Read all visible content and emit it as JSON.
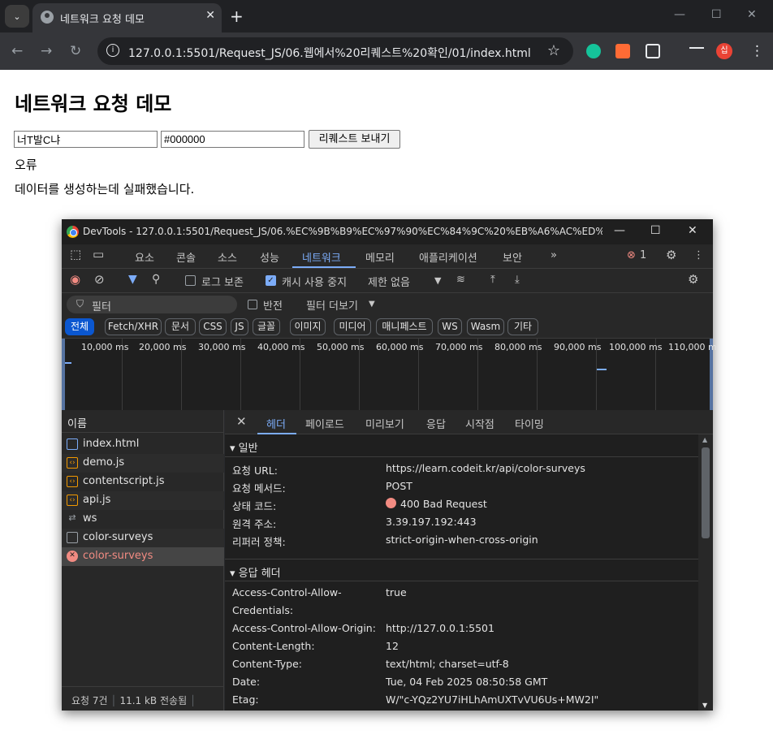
{
  "browser": {
    "tab_title": "네트워크 요청 데모",
    "tab_close": "✕",
    "new_tab": "+",
    "url": "127.0.0.1:5501/Request_JS/06.웹에서%20리퀘스트%20확인/01/index.html",
    "profile_initial": "십"
  },
  "page": {
    "heading": "네트워크 요청 데모",
    "name_value": "너T발C냐",
    "color_value": "#000000",
    "send_button": "리퀘스트 보내기",
    "error_title": "오류",
    "error_message": "데이터를 생성하는데 실패했습니다."
  },
  "devtools": {
    "window_title": "DevTools - 127.0.0.1:5501/Request_JS/06.%EC%9B%B9%EC%97%90%EC%84%9C%20%EB%A6%AC%ED%80%98%EC...",
    "panel_tabs": [
      "요소",
      "콘솔",
      "소스",
      "성능",
      "네트워크",
      "메모리",
      "애플리케이션",
      "보안"
    ],
    "more_tabs": "»",
    "error_count": "1",
    "toolbar": {
      "preserve_log": "로그 보존",
      "disable_cache": "캐시 사용 중지",
      "throttle": "제한 없음"
    },
    "filter": {
      "placeholder": "필터",
      "invert": "반전",
      "more_filters": "필터 더보기"
    },
    "type_filters": [
      "전체",
      "Fetch/XHR",
      "문서",
      "CSS",
      "JS",
      "글꼴",
      "이미지",
      "미디어",
      "매니페스트",
      "WS",
      "Wasm",
      "기타"
    ],
    "timeline_ticks": [
      "10,000 ms",
      "20,000 ms",
      "30,000 ms",
      "40,000 ms",
      "50,000 ms",
      "60,000 ms",
      "70,000 ms",
      "80,000 ms",
      "90,000 ms",
      "100,000 ms",
      "110,000 m"
    ],
    "name_header": "이름",
    "requests": [
      {
        "name": "index.html",
        "icon": "document-icon",
        "color": "#7cacf8"
      },
      {
        "name": "demo.js",
        "icon": "script-icon",
        "color": "#f29900"
      },
      {
        "name": "contentscript.js",
        "icon": "script-icon",
        "color": "#f29900"
      },
      {
        "name": "api.js",
        "icon": "script-icon",
        "color": "#f29900"
      },
      {
        "name": "ws",
        "icon": "websocket-icon",
        "color": "#9aa0a6"
      },
      {
        "name": "color-surveys",
        "icon": "blank-icon",
        "color": "#9aa0a6"
      },
      {
        "name": "color-surveys",
        "icon": "error-icon",
        "color": "#f28b82"
      }
    ],
    "status_bar": {
      "requests": "요청 7건",
      "transferred": "11.1 kB 전송됨"
    },
    "detail_tabs": [
      "헤더",
      "페이로드",
      "미리보기",
      "응답",
      "시작점",
      "타이밍"
    ],
    "general": {
      "title": "일반",
      "rows": [
        {
          "key": "요청 URL:",
          "value": "https://learn.codeit.kr/api/color-surveys"
        },
        {
          "key": "요청 메서드:",
          "value": "POST"
        },
        {
          "key": "상태 코드:",
          "value": "400 Bad Request"
        },
        {
          "key": "원격 주소:",
          "value": "3.39.197.192:443"
        },
        {
          "key": "리퍼러 정책:",
          "value": "strict-origin-when-cross-origin"
        }
      ]
    },
    "response_headers": {
      "title": "응답 헤더",
      "rows": [
        {
          "key": "Access-Control-Allow-",
          "key2": "Credentials:",
          "value": "true"
        },
        {
          "key": "Access-Control-Allow-Origin:",
          "value": "http://127.0.0.1:5501"
        },
        {
          "key": "Content-Length:",
          "value": "12"
        },
        {
          "key": "Content-Type:",
          "value": "text/html; charset=utf-8"
        },
        {
          "key": "Date:",
          "value": "Tue, 04 Feb 2025 08:50:58 GMT"
        },
        {
          "key": "Etag:",
          "value": "W/\"c-YQz2YU7iHLhAmUXTvVU6Us+MW2I\""
        }
      ]
    }
  }
}
